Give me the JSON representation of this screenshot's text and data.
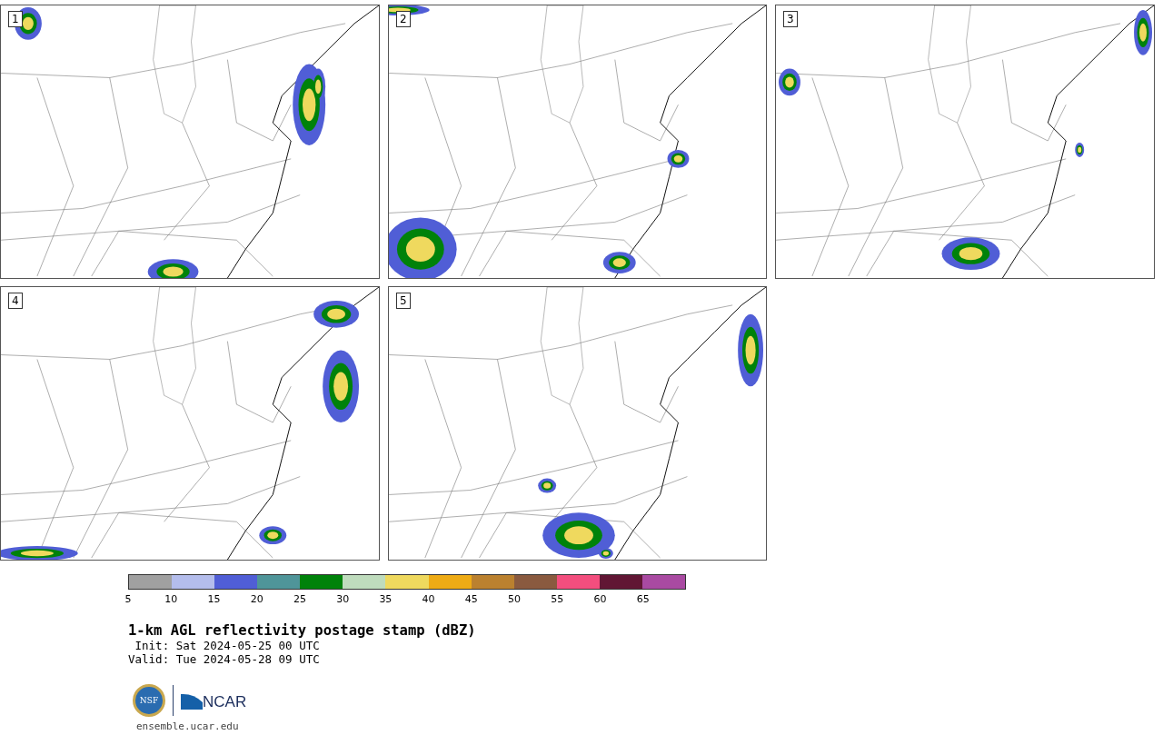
{
  "panels": [
    {
      "label": "1"
    },
    {
      "label": "2"
    },
    {
      "label": "3"
    },
    {
      "label": "4"
    },
    {
      "label": "5"
    }
  ],
  "colorbar": {
    "bins": [
      {
        "color": "#a0a0a0"
      },
      {
        "color": "#b4bdec"
      },
      {
        "color": "#505ed6"
      },
      {
        "color": "#4f9599"
      },
      {
        "color": "#00820a"
      },
      {
        "color": "#bfdcbd"
      },
      {
        "color": "#efd95e"
      },
      {
        "color": "#eeab15"
      },
      {
        "color": "#bb812f"
      },
      {
        "color": "#8a5a3f"
      },
      {
        "color": "#f34e7e"
      },
      {
        "color": "#611634"
      },
      {
        "color": "#a94aa2"
      }
    ],
    "ticks": [
      "5",
      "10",
      "15",
      "20",
      "25",
      "30",
      "35",
      "40",
      "45",
      "50",
      "55",
      "60",
      "65"
    ]
  },
  "title": "1-km AGL reflectivity postage stamp (dBZ)",
  "init": " Init: Sat 2024-05-25 00 UTC",
  "valid": "Valid: Tue 2024-05-28 09 UTC",
  "logos": {
    "nsf": "NSF",
    "ncar": "NCAR"
  },
  "url": "ensemble.ucar.edu"
}
